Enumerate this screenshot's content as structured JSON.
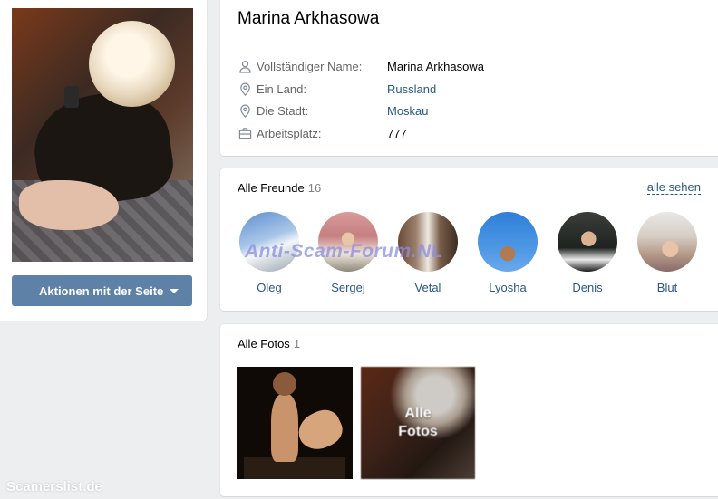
{
  "profile": {
    "name": "Marina Arkhasowa",
    "actions_button": "Aktionen mit der Seite"
  },
  "info": [
    {
      "icon": "person-icon",
      "label": "Vollständiger Name:",
      "value": "Marina Arkhasowa",
      "is_link": false
    },
    {
      "icon": "location-pin-icon",
      "label": "Ein Land:",
      "value": "Russland",
      "is_link": true
    },
    {
      "icon": "location-pin-icon",
      "label": "Die Stadt:",
      "value": "Moskau",
      "is_link": true
    },
    {
      "icon": "briefcase-icon",
      "label": "Arbeitsplatz:",
      "value": "777",
      "is_link": false
    }
  ],
  "friends": {
    "title": "Alle Freunde",
    "count": "16",
    "see_all": "alle sehen",
    "items": [
      {
        "name": "Oleg"
      },
      {
        "name": "Sergej"
      },
      {
        "name": "Vetal"
      },
      {
        "name": "Lyosha"
      },
      {
        "name": "Denis"
      },
      {
        "name": "Blut"
      }
    ]
  },
  "photos": {
    "title": "Alle Fotos",
    "count": "1",
    "all_photos_label": "Alle Fotos"
  },
  "watermarks": {
    "overlay": "Anti-Scam-Forum.NL",
    "site": "Scamerslist.de"
  },
  "colors": {
    "accent": "#5e81a8",
    "link": "#2a5885",
    "background": "#edeef0"
  }
}
